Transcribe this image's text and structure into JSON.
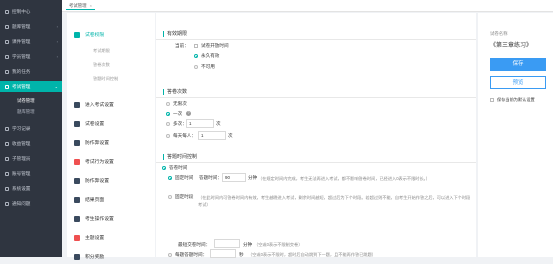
{
  "sidebar": {
    "items": [
      {
        "label": "控制中心",
        "active": false
      },
      {
        "label": "题库管理",
        "active": false
      },
      {
        "label": "课件管理",
        "active": false
      },
      {
        "label": "学员管理",
        "active": false
      },
      {
        "label": "我的任务",
        "active": false
      },
      {
        "label": "考试管理",
        "active": true
      },
      {
        "label": "学习记录",
        "active": false
      },
      {
        "label": "收益管理",
        "active": false
      },
      {
        "label": "子管理员",
        "active": false
      },
      {
        "label": "账号管理",
        "active": false
      },
      {
        "label": "系统设置",
        "active": false
      },
      {
        "label": "通知问题",
        "active": false
      }
    ],
    "subitems": [
      {
        "label": "试卷管理",
        "selected": true
      },
      {
        "label": "题库管理",
        "selected": false
      }
    ]
  },
  "topbar": {
    "tab_label": "考试管理",
    "close_glyph": "×"
  },
  "menu": {
    "items": [
      {
        "label": "试卷权限",
        "color": "#00b4aa",
        "selected": true
      },
      {
        "label": "进入考试设置",
        "color": "#3a4a5e"
      },
      {
        "label": "试卷设置",
        "color": "#3a4a5e"
      },
      {
        "label": "防作弊设置",
        "color": "#3a4a5e"
      },
      {
        "label": "考试行为设置",
        "color": "#ef5050"
      },
      {
        "label": "防作弊设置",
        "color": "#3a4a5e"
      },
      {
        "label": "结果页面",
        "color": "#3a4a5e"
      },
      {
        "label": "考生操作设置",
        "color": "#3a4a5e"
      },
      {
        "label": "主题设置",
        "color": "#ef5050"
      },
      {
        "label": "积分奖励",
        "color": "#3a4a5e"
      }
    ],
    "subitems": [
      "考试期限",
      "答卷次数",
      "答题时间控制"
    ]
  },
  "validity": {
    "section_title": "有效期限",
    "row_label": "当前：",
    "options": [
      {
        "label": "试卷开放时间",
        "kind": "checkbox",
        "checked": false
      },
      {
        "label": "永久有效",
        "kind": "radio",
        "checked": true
      },
      {
        "label": "不可用",
        "kind": "radio",
        "checked": false
      }
    ]
  },
  "attempts": {
    "section_title": "答卷次数",
    "options": [
      {
        "label": "无限次",
        "checked": false
      },
      {
        "label": "一次",
        "checked": true
      },
      {
        "label": "多次：",
        "checked": false,
        "value": "1",
        "unit": "次"
      },
      {
        "label": "每天每人：",
        "checked": false,
        "value": "1",
        "unit": "次"
      }
    ]
  },
  "time_control": {
    "section_title": "答题时间控制",
    "mode_label": "答卷时间",
    "fixed": {
      "label": "固定时间",
      "duration_label": "答题时间：",
      "duration_value": "90",
      "duration_unit": "分钟",
      "note": "（在规定时间内完成，考生无法再进入考试，都不影响答卷时间，已经进入0表示不限时长。）"
    },
    "fixed_period": {
      "label": "固定时段",
      "note": "（在此时间内可答卷时间内有效，考生越晚进入考试，剩余时间越短，超过后为下个时段。若超过则不能，自考生开始作答之后，可以进入下个时段考试）"
    },
    "submit_label": "最短交卷时间：",
    "submit_unit": "分钟",
    "submit_note": "（空或0表示不限制交卷）",
    "per_question_label": "每题答题时间：",
    "per_question_unit": "秒",
    "per_question_note": "（空或0表示不限时，超时后自动跳到下一题，且不能再作答已跳题）"
  },
  "right_panel": {
    "name_label": "试卷名称",
    "name_value": "《第三章练习》",
    "save_label": "保存",
    "preview_label": "预览",
    "set_default_label": "保存当前为默认设置"
  }
}
